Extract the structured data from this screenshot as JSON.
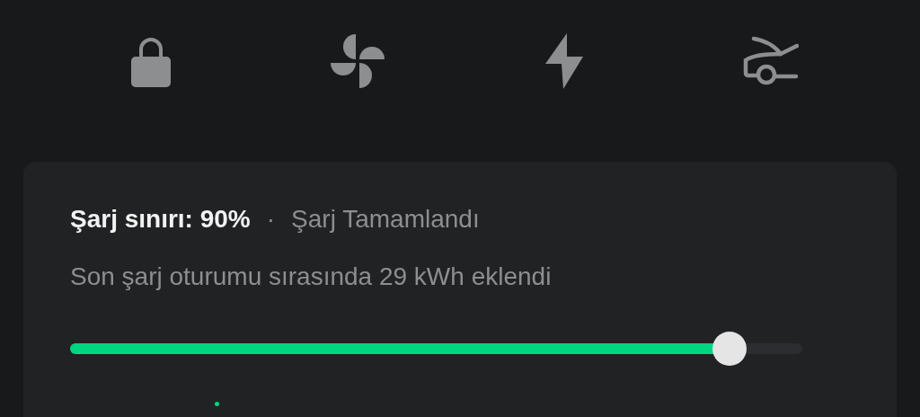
{
  "quick_controls": [
    {
      "kind": "lock"
    },
    {
      "kind": "fan"
    },
    {
      "kind": "charge"
    },
    {
      "kind": "trunk"
    }
  ],
  "charge_card": {
    "limit_label": "Şarj sınırı: 90%",
    "separator": "·",
    "status": "Şarj Tamamlandı",
    "session_info": "Son şarj oturumu sırasında 29 kWh eklendi",
    "slider": {
      "level": 0.9
    }
  }
}
